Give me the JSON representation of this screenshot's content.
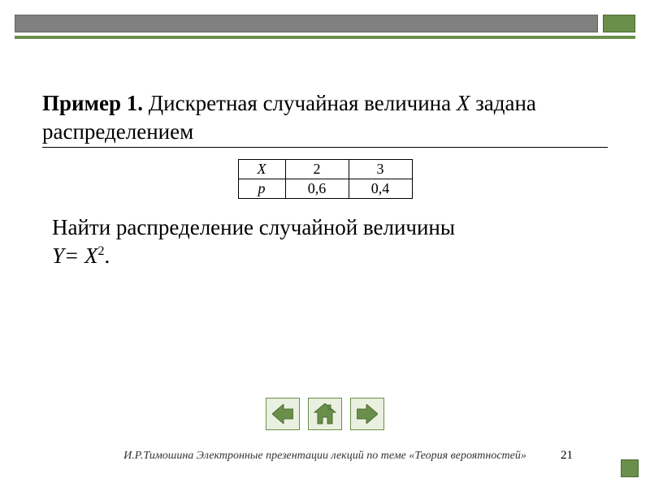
{
  "heading": {
    "bold": "Пример 1.",
    "rest_before_X": " Дискретная случайная величина ",
    "var": "X",
    "rest_after_X": " задана распределением"
  },
  "table": {
    "row1_header": "X",
    "row2_header": "p",
    "cells": {
      "r1c1": "2",
      "r1c2": "3",
      "r2c1": "0,6",
      "r2c2": "0,4"
    }
  },
  "task": {
    "line1": "Найти распределение случайной величины",
    "eq_lhs": "Y= X",
    "eq_exp": "2",
    "eq_tail": "."
  },
  "nav": {
    "prev": "prev-slide",
    "home": "home",
    "next": "next-slide"
  },
  "footer": "И.Р.Тимошина Электронные презентации лекций по теме «Теория вероятностей»",
  "page_number": "21",
  "colors": {
    "accent": "#6a8f4a",
    "gray": "#808080"
  },
  "chart_data": {
    "type": "table",
    "title": "Распределение дискретной случайной величины X",
    "columns": [
      "X",
      "p"
    ],
    "rows": [
      {
        "X": 2,
        "p": 0.6
      },
      {
        "X": 3,
        "p": 0.4
      }
    ]
  }
}
